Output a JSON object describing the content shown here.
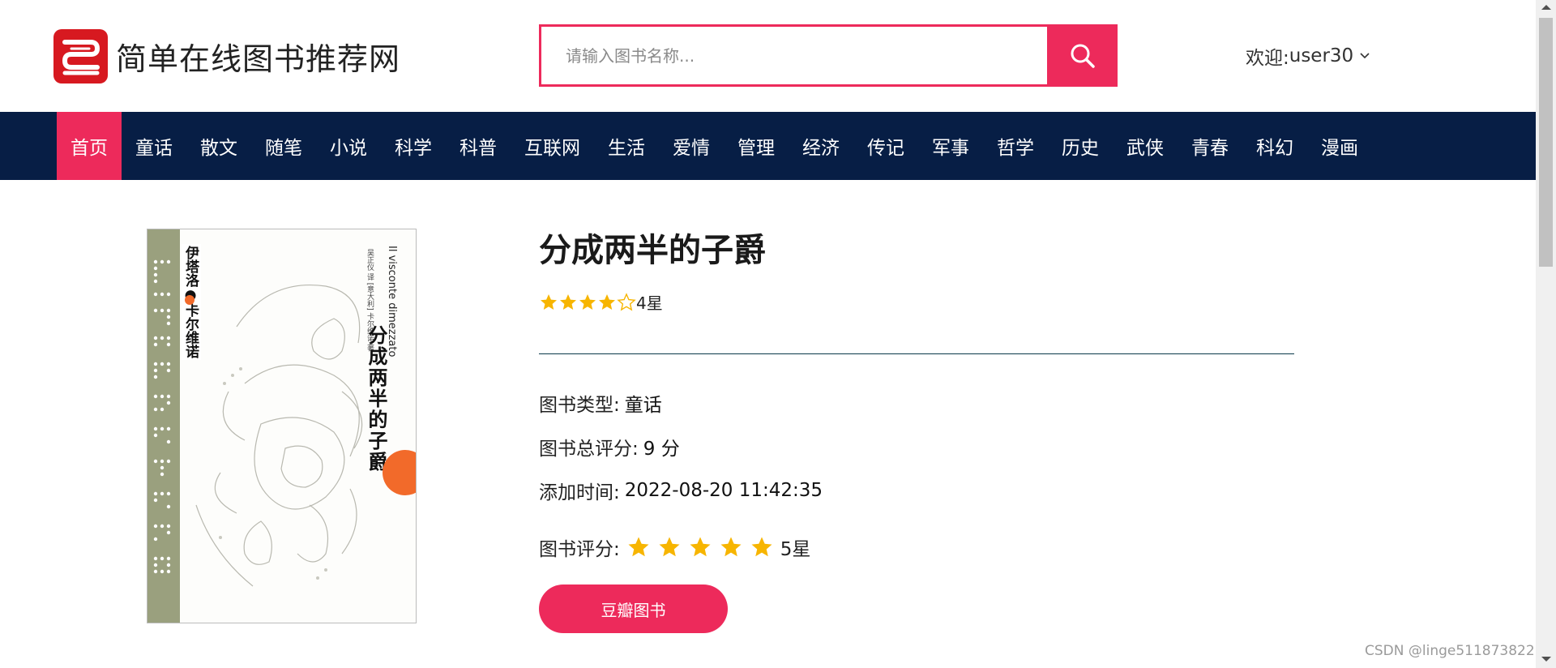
{
  "site": {
    "logo_icon": "book-logo-icon",
    "title": "简单在线图书推荐网",
    "brand_color": "#ed2a5b",
    "nav_color": "#071e45"
  },
  "search": {
    "placeholder": "请输入图书名称...",
    "value": "",
    "icon": "search-icon"
  },
  "user": {
    "greeting": "欢迎:",
    "name": "user30"
  },
  "nav": {
    "items": [
      {
        "label": "首页",
        "active": true
      },
      {
        "label": "童话"
      },
      {
        "label": "散文"
      },
      {
        "label": "随笔"
      },
      {
        "label": "小说"
      },
      {
        "label": "科学"
      },
      {
        "label": "科普"
      },
      {
        "label": "互联网"
      },
      {
        "label": "生活"
      },
      {
        "label": "爱情"
      },
      {
        "label": "管理"
      },
      {
        "label": "经济"
      },
      {
        "label": "传记"
      },
      {
        "label": "军事"
      },
      {
        "label": "哲学"
      },
      {
        "label": "历史"
      },
      {
        "label": "武侠"
      },
      {
        "label": "青春"
      },
      {
        "label": "科幻"
      },
      {
        "label": "漫画"
      }
    ]
  },
  "book": {
    "title": "分成两半的子爵",
    "avg_rating_stars": 4,
    "avg_rating_max": 5,
    "avg_rating_text": "4星",
    "type_label": "图书类型:",
    "type_value": "童话",
    "score_label": "图书总评分:",
    "score_value": "9 分",
    "added_label": "添加时间:",
    "added_value": "2022-08-20 11:42:35",
    "rate_label": "图书评分:",
    "user_rating_stars": 5,
    "user_rating_max": 5,
    "user_rating_text": "5星",
    "douban_button": "豆瓣图书",
    "star_color": "#f7b500",
    "cover": {
      "author": "伊塔洛●卡尔维诺",
      "title": "分成两半的子爵",
      "latin": "Il visconte dimezzato",
      "translator": "吴正仪 译 [意大利] 卡尔维诺 著",
      "accent_color": "#f26a2a",
      "stripe_color": "#9aa07e"
    }
  },
  "watermark": "CSDN @linge511873822"
}
